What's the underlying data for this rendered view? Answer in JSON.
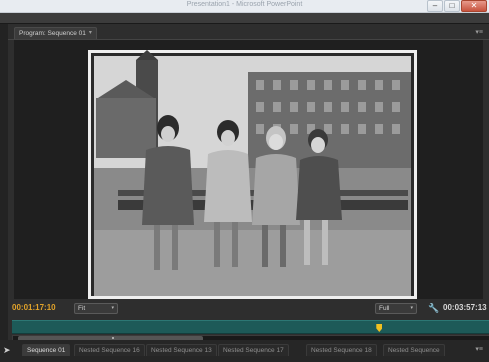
{
  "window": {
    "title": "Presentation1 - Microsoft PowerPoint",
    "min": "–",
    "max": "□",
    "close": "✕"
  },
  "monitor": {
    "tab_label": "Program: Sequence 01",
    "tab_chevron": "▾",
    "panel_menu": "▾≡",
    "timecode_current": "00:01:17:10",
    "timecode_duration": "00:03:57:13",
    "zoom_select": "Fit",
    "quality_select": "Full",
    "dropdown_arrow": "▾",
    "wrench_icon": "wrench-icon"
  },
  "transport": {
    "buttons": [
      {
        "name": "add-marker-button",
        "glyph": "▼"
      },
      {
        "name": "mark-in-button",
        "glyph": "{"
      },
      {
        "name": "mark-out-button",
        "glyph": "}"
      },
      {
        "name": "go-to-in-button",
        "glyph": "{←"
      },
      {
        "name": "step-back-button",
        "glyph": "◀|"
      },
      {
        "name": "play-button",
        "glyph": "▶"
      },
      {
        "name": "step-forward-button",
        "glyph": "|▶"
      },
      {
        "name": "go-to-out-button",
        "glyph": "→}"
      },
      {
        "name": "lift-button",
        "glyph": "⇧"
      },
      {
        "name": "extract-button",
        "glyph": "⇪"
      },
      {
        "name": "export-frame-button",
        "glyph": "📷"
      }
    ],
    "add_button": "+"
  },
  "timeline": {
    "playhead_position": 0.77,
    "tabs": [
      "Sequence 01",
      "Nested Sequence 16",
      "Nested Sequence 13",
      "Nested Sequence 17",
      "Nested Sequence 18",
      "Nested Sequence"
    ],
    "tab_menu": "▾≡",
    "tool_arrow": "➤"
  }
}
